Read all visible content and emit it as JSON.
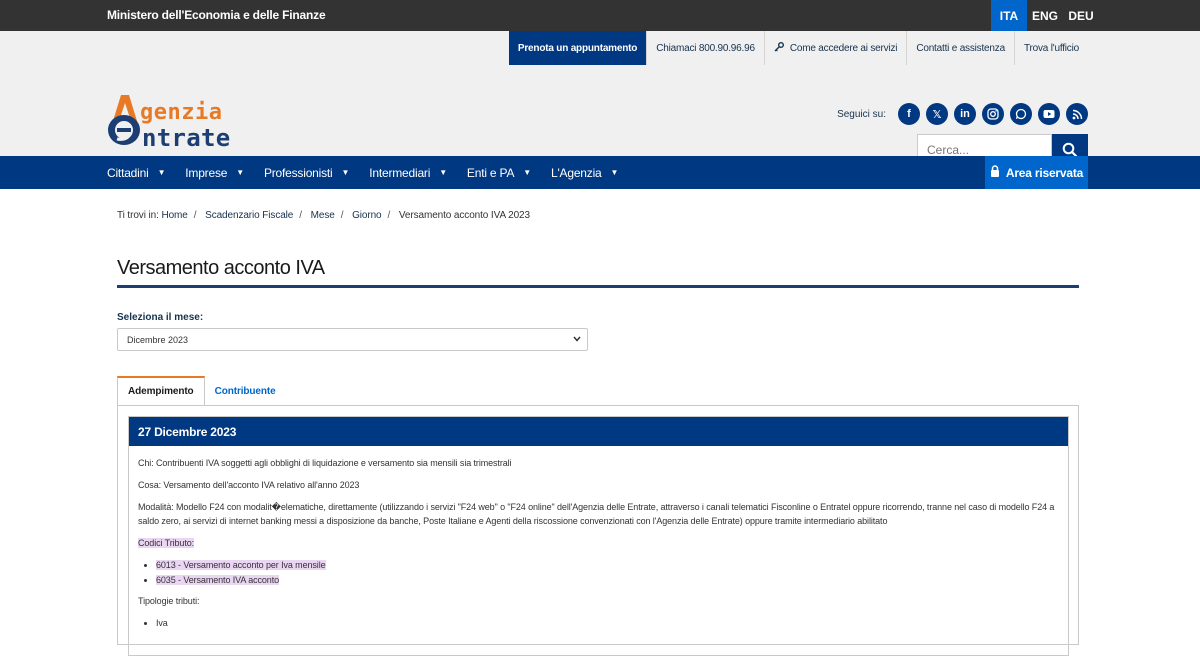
{
  "topbar": {
    "ministry": "Ministero dell'Economia e delle Finanze",
    "languages": [
      "ITA",
      "ENG",
      "DEU"
    ],
    "active_language": "ITA"
  },
  "header": {
    "links": {
      "appointment": "Prenota un appuntamento",
      "call": "Chiamaci 800.90.96.96",
      "access": "Come accedere ai servizi",
      "contacts": "Contatti e assistenza",
      "office": "Trova l'ufficio"
    },
    "logo": {
      "line1": "genzia",
      "line2": "ntrate"
    },
    "social_label": "Seguici su:",
    "social_icons": [
      "facebook-icon",
      "x-icon",
      "linkedin-icon",
      "instagram-icon",
      "whatsapp-icon",
      "youtube-icon",
      "rss-icon"
    ],
    "search_placeholder": "Cerca..."
  },
  "nav": {
    "items": [
      "Cittadini",
      "Imprese",
      "Professionisti",
      "Intermediari",
      "Enti e PA",
      "L'Agenzia"
    ],
    "reserved": "Area riservata"
  },
  "breadcrumb": {
    "prefix": "Ti trovi in:",
    "items": [
      "Home",
      "Scadenzario Fiscale",
      "Mese",
      "Giorno"
    ],
    "current": "Versamento acconto IVA 2023"
  },
  "page": {
    "title": "Versamento acconto IVA",
    "select_label": "Seleziona il mese:",
    "select_value": "Dicembre 2023",
    "tabs": [
      "Adempimento",
      "Contribuente"
    ]
  },
  "card": {
    "date": "27 Dicembre 2023",
    "chi": "Chi: Contribuenti IVA soggetti agli obblighi di liquidazione e versamento sia mensili sia trimestrali",
    "cosa": "Cosa: Versamento dell'acconto IVA relativo all'anno 2023",
    "modalita": "Modalità: Modello F24 con modalit�elematiche, direttamente (utilizzando i servizi \"F24 web\" o \"F24 online\" dell'Agenzia delle Entrate, attraverso i canali telematici Fisconline o Entratel oppure ricorrendo, tranne nel caso di modello F24 a saldo zero, ai servizi di internet banking messi a disposizione da banche, Poste Italiane e Agenti della riscossione convenzionati con l'Agenzia delle Entrate) oppure tramite intermediario abilitato",
    "codici_label": "Codici Tributo:",
    "codici": [
      "6013 - Versamento acconto per Iva mensile",
      "6035 - Versamento IVA acconto"
    ],
    "tipologie_label": "Tipologie tributi:",
    "tipologie": [
      "Iva"
    ]
  }
}
